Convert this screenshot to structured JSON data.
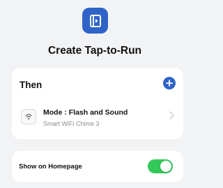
{
  "header": {
    "title": "Create Tap-to-Run",
    "icon": "tap-to-run-icon",
    "accent_color": "#2f63c8"
  },
  "then_section": {
    "title": "Then",
    "add_icon": "plus-icon",
    "actions": [
      {
        "label": "Mode : Flash and Sound",
        "device": "Smart WiFi Chime 3",
        "icon": "chime-device-icon"
      }
    ]
  },
  "homepage": {
    "label": "Show on Homepage",
    "toggle_on": true,
    "toggle_color": "#34c759"
  }
}
